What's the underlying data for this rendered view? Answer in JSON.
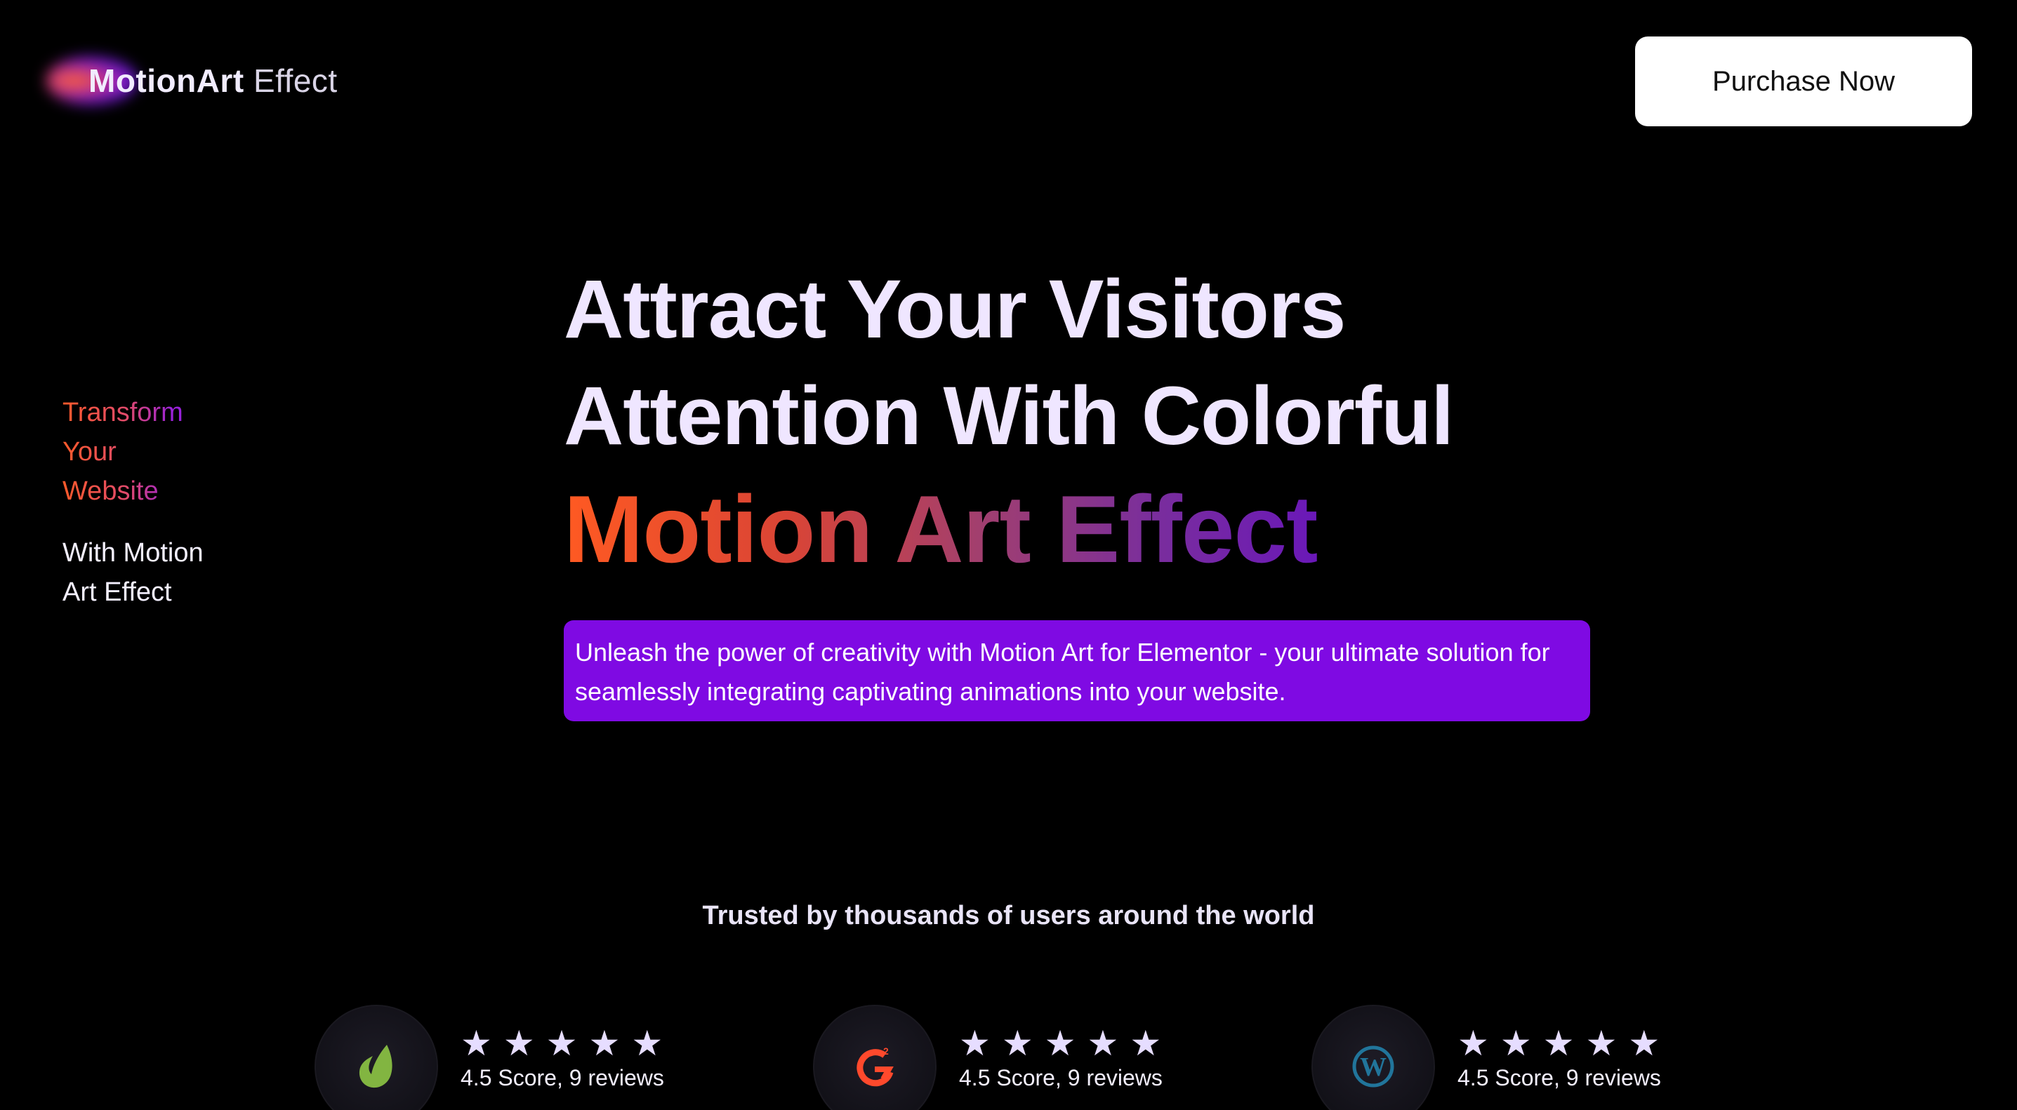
{
  "header": {
    "logo_strong": "MotionArt",
    "logo_light": "Effect",
    "purchase_label": "Purchase Now"
  },
  "tagline": {
    "line1": "Transform",
    "line2": "Your",
    "line3": "Website",
    "sub_line1": "With Motion",
    "sub_line2": "Art Effect"
  },
  "hero": {
    "title_line1": "Attract Your Visitors",
    "title_line2": "Attention With Colorful",
    "title_highlight": "Motion Art Effect",
    "description": "Unleash the power of creativity with Motion Art for Elementor - your ultimate solution for seamlessly integrating captivating animations into your website."
  },
  "trust": {
    "heading": "Trusted by thousands of users around the world",
    "ratings": [
      {
        "platform_icon": "envato-leaf-icon",
        "stars": 5,
        "score_text": "4.5 Score, 9 reviews"
      },
      {
        "platform_icon": "g2-icon",
        "stars": 5,
        "score_text": "4.5 Score, 9 reviews"
      },
      {
        "platform_icon": "wordpress-icon",
        "stars": 5,
        "score_text": "4.5 Score, 9 reviews"
      }
    ]
  },
  "colors": {
    "background": "#000000",
    "accent_purple": "#7f0ae3",
    "gradient_orange": "#ff5a22",
    "gradient_purple": "#6a18b8",
    "envato_green": "#82b541",
    "g2_red": "#ff492c",
    "wordpress_blue": "#21759b"
  }
}
